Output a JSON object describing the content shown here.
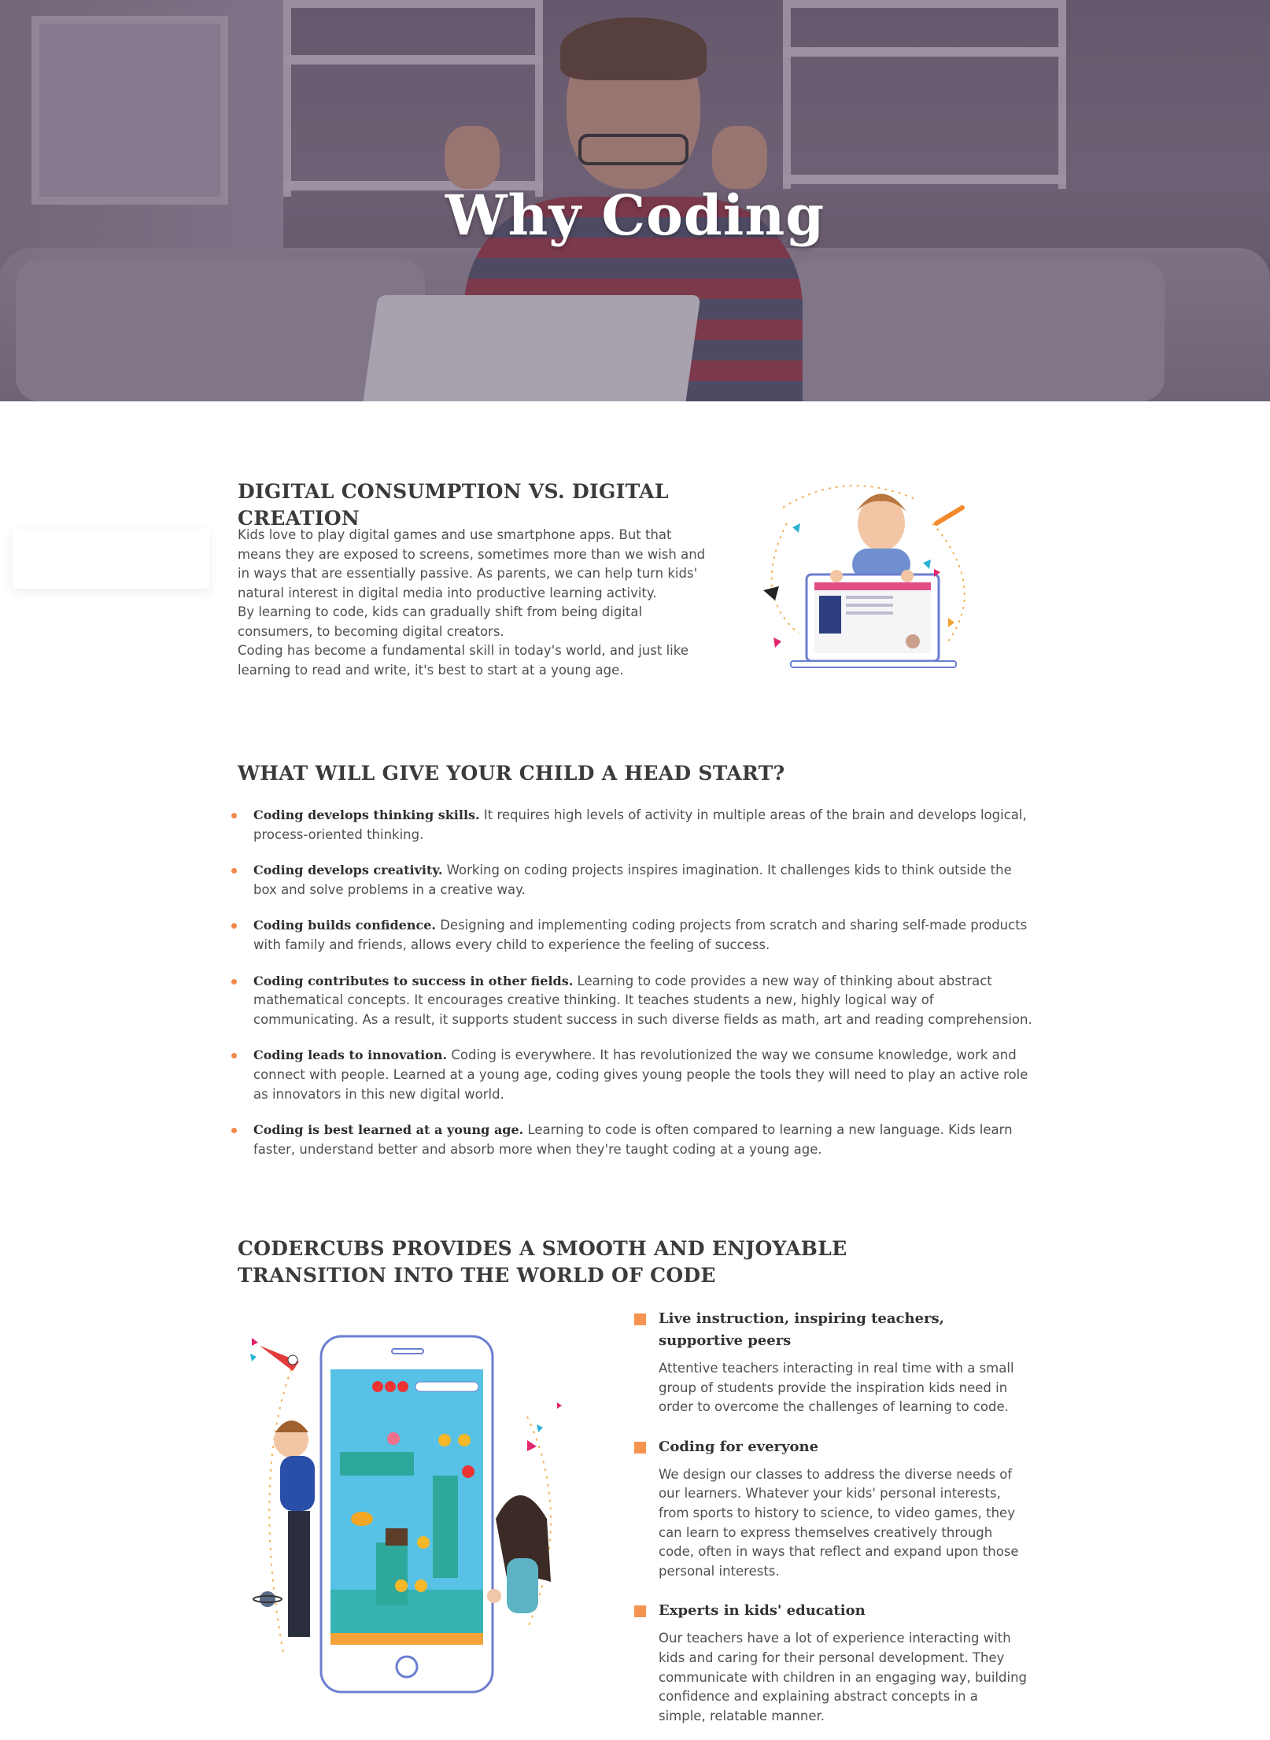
{
  "hero": {
    "title": "Why Coding"
  },
  "section1": {
    "title": "DIGITAL CONSUMPTION VS. DIGITAL CREATION",
    "paragraphs": [
      "Kids love to play digital games and use smartphone apps. But that means they are exposed to screens, sometimes more than we wish and in ways that are essentially passive. As parents, we can help turn kids' natural interest in digital media into productive learning activity.",
      "By learning to code, kids can gradually shift from being digital consumers, to becoming digital creators.",
      "Coding has become a fundamental skill in today's world, and just like learning to read and write, it's best to start at a young age."
    ]
  },
  "section2": {
    "title": "WHAT WILL GIVE YOUR CHILD A HEAD START?",
    "items": [
      {
        "bold": "Coding develops thinking skills.",
        "text": " It requires high levels of activity in multiple areas of the brain and develops logical, process-oriented thinking."
      },
      {
        "bold": "Coding develops creativity.",
        "text": " Working on coding projects inspires imagination. It challenges kids to think outside the box and solve problems in a creative way."
      },
      {
        "bold": "Coding builds confidence.",
        "text": " Designing and implementing coding projects from scratch and sharing self-made products with family and friends, allows every child to experience the feeling of success."
      },
      {
        "bold": "Coding contributes to success in other fields.",
        "text": " Learning to code provides a new way of thinking about abstract mathematical concepts. It encourages creative thinking. It teaches students a new, highly logical way of communicating. As a result, it supports student success in such diverse fields as math, art and reading comprehension."
      },
      {
        "bold": "Coding leads to innovation.",
        "text": " Coding is everywhere. It has revolutionized the way we consume knowledge, work and connect with people. Learned at a young age, coding gives young people the tools they will need to play an active role as innovators in this new digital world."
      },
      {
        "bold": "Coding is best learned at a young age.",
        "text": " Learning to code is often compared to learning a new language. Kids learn faster, understand better and absorb more when they're taught coding at a young age."
      }
    ]
  },
  "section3": {
    "title": "CODERCUBS PROVIDES A SMOOTH AND ENJOYABLE TRANSITION INTO THE WORLD OF CODE",
    "features": [
      {
        "title": "Live instruction, inspiring teachers, supportive peers",
        "text": "Attentive teachers interacting in real time with a small group of students provide the inspiration kids need in order to overcome the challenges of learning to code."
      },
      {
        "title": "Coding for everyone",
        "text": "We design our classes to address the diverse needs of our learners. Whatever your kids' personal interests, from sports to history to science, to video games, they can learn to express themselves creatively through code, often in ways that reflect and expand upon those personal interests."
      },
      {
        "title": "Experts in kids' education",
        "text": "Our teachers have a lot of experience interacting with kids and caring for their personal development. They communicate with children in an engaging way, building confidence and explaining abstract concepts in a simple, relatable manner."
      }
    ]
  },
  "colors": {
    "accent": "#f59451",
    "heading": "#3b3b3b",
    "body": "#4f4f4f"
  }
}
